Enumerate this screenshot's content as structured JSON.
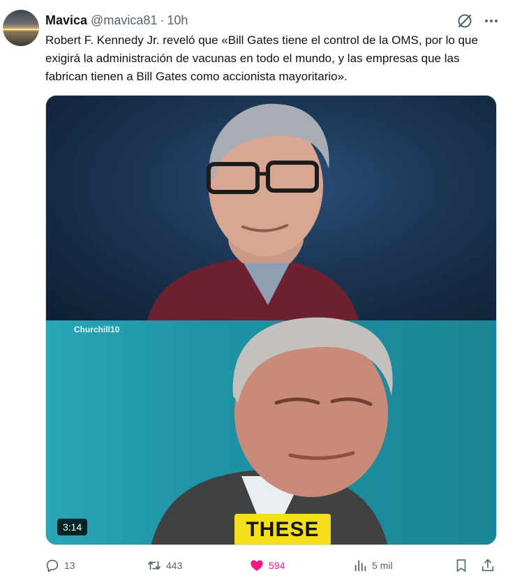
{
  "author": {
    "display_name": "Mavica",
    "handle": "@mavica81",
    "separator": "·",
    "time": "10h"
  },
  "tweet": {
    "text": "Robert F. Kennedy Jr. reveló que «Bill Gates tiene el control de la OMS, por lo que exigirá la administración de vacunas en todo el mundo, y las empresas que las fabrican tienen a Bill Gates como accionista mayoritario»."
  },
  "media": {
    "watermark": "Churchill10",
    "caption": "THESE",
    "duration": "3:14"
  },
  "actions": {
    "replies": "13",
    "reposts": "443",
    "likes": "594",
    "views": "5 mil"
  },
  "icons": {
    "header": [
      "grok-icon",
      "more-icon"
    ],
    "actions": [
      "reply-icon",
      "repost-icon",
      "like-icon",
      "views-icon",
      "bookmark-icon",
      "share-icon"
    ]
  },
  "colors": {
    "text": "#0f1419",
    "secondary": "#536471",
    "like": "#f91880",
    "caption_banner": "#f5de1c"
  }
}
